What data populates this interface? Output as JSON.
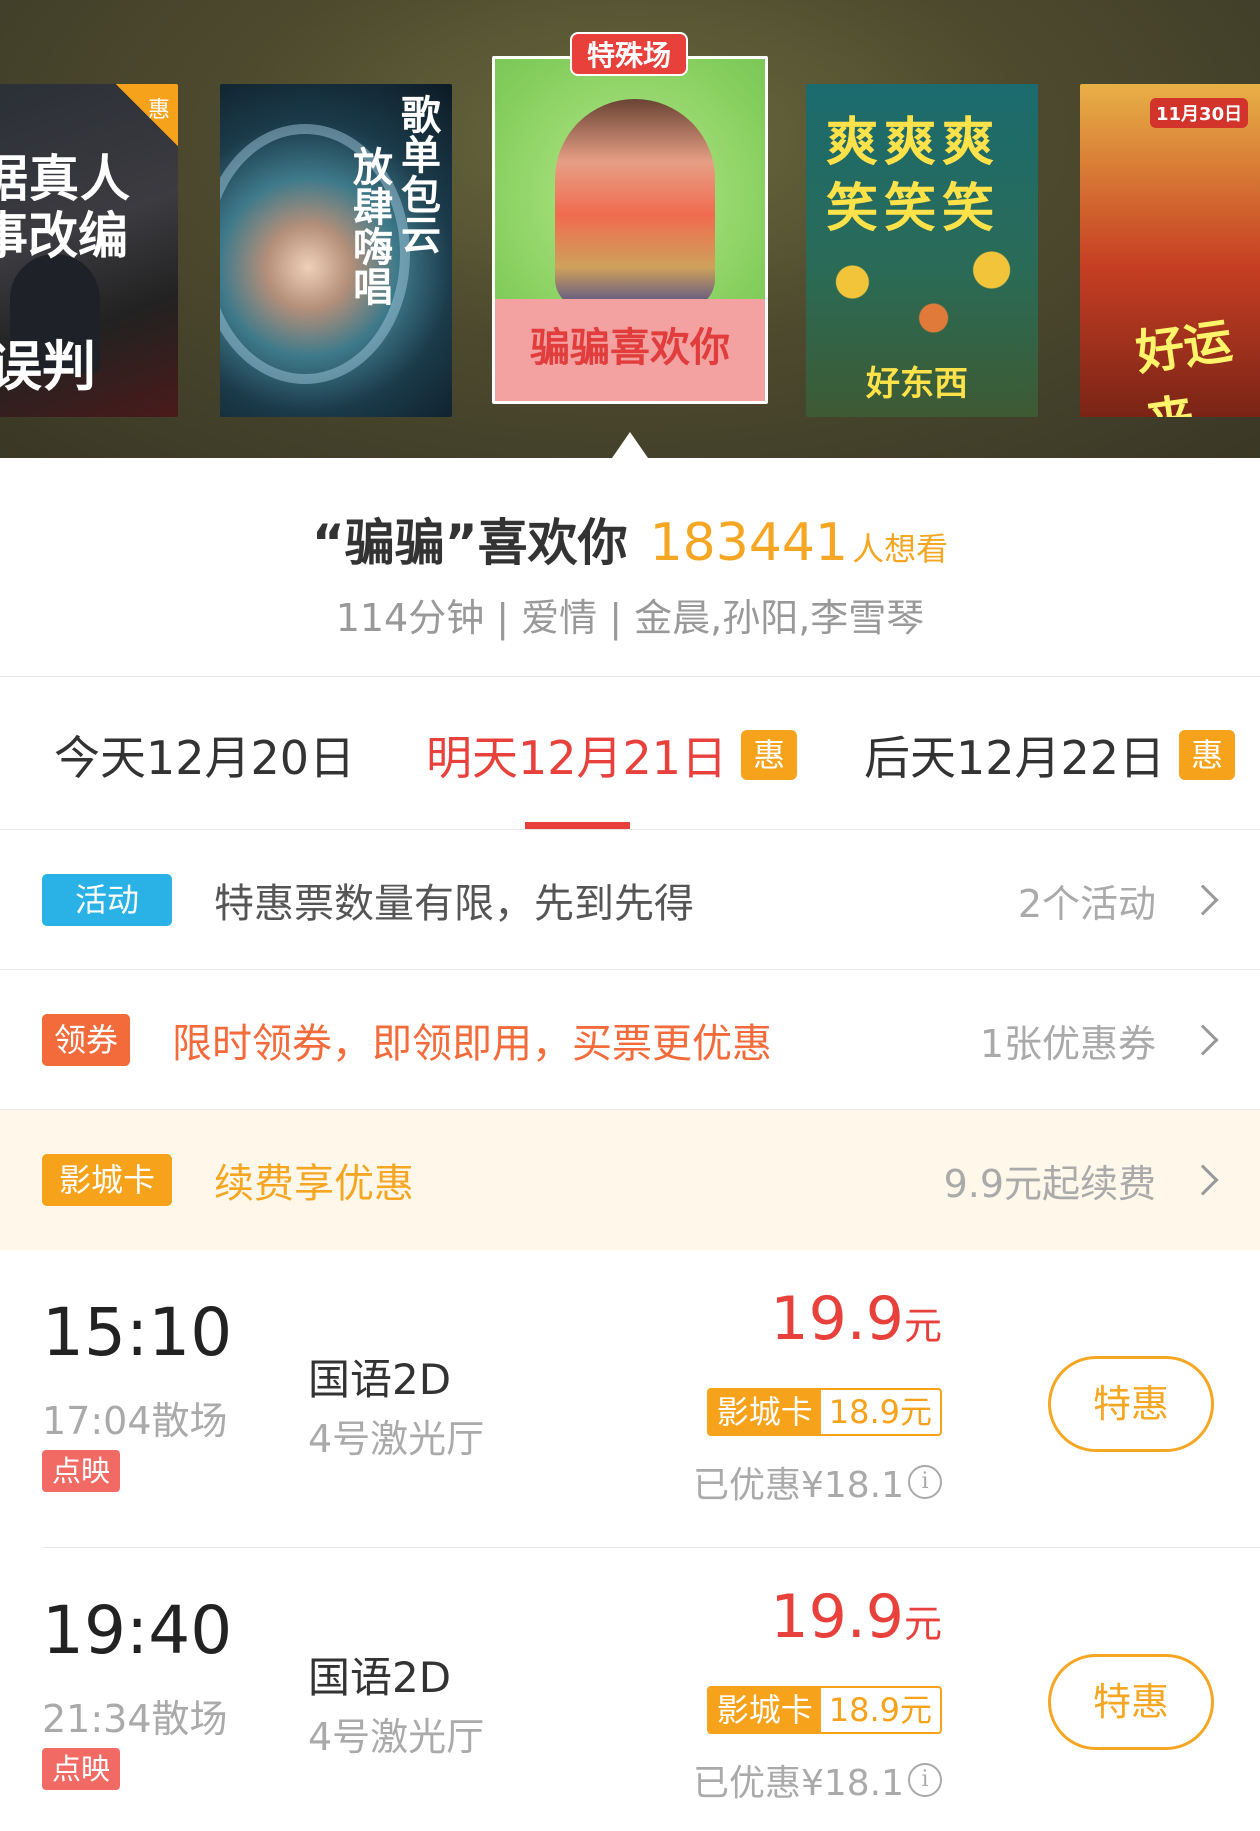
{
  "carousel": {
    "posters": [
      {
        "badge": "惠",
        "line1": "据真人",
        "line2": "事改编",
        "line3": "误判"
      },
      {
        "line1": "歌单包云",
        "line2": "放肆嗨唱"
      },
      {
        "tag": "特殊场",
        "title": "骗骗喜欢你"
      },
      {
        "line1": "爽爽爽",
        "line2": "笑笑笑",
        "line3": "好东西"
      },
      {
        "line1": "好运来",
        "line2": "11月30日"
      }
    ]
  },
  "movie": {
    "name": "“骗骗”喜欢你",
    "want_count": "183441",
    "want_label": "人想看",
    "meta": "114分钟 | 爱情 | 金晨,孙阳,李雪琴"
  },
  "dates": [
    {
      "label": "今天12月20日",
      "badge": ""
    },
    {
      "label": "明天12月21日",
      "badge": "惠"
    },
    {
      "label": "后天12月22日",
      "badge": "惠"
    }
  ],
  "promos": {
    "activity": {
      "badge": "活动",
      "text": "特惠票数量有限，先到先得",
      "right": "2个活动"
    },
    "coupon": {
      "badge": "领券",
      "text": "限时领券，即领即用，买票更优惠",
      "right": "1张优惠券"
    },
    "card": {
      "badge": "影城卡",
      "text": "续费享优惠",
      "right": "9.9元起续费"
    }
  },
  "showtimes": [
    {
      "start": "15:10",
      "end": "17:04散场",
      "tag": "点映",
      "lang": "国语2D",
      "hall": "4号激光厅",
      "price": "19.9",
      "unit": "元",
      "card_label": "影城卡",
      "card_price": "18.9元",
      "saved": "已优惠¥18.1",
      "button": "特惠"
    },
    {
      "start": "19:40",
      "end": "21:34散场",
      "tag": "点映",
      "lang": "国语2D",
      "hall": "4号激光厅",
      "price": "19.9",
      "unit": "元",
      "card_label": "影城卡",
      "card_price": "18.9元",
      "saved": "已优惠¥18.1",
      "button": "特惠"
    }
  ],
  "icons": {
    "info": "i",
    "chevron": "chevron-right-icon"
  },
  "colors": {
    "accent_red": "#e8413c",
    "accent_orange": "#f5a623",
    "activity_blue": "#2ab1e6",
    "coupon_orange": "#f36b3a"
  }
}
